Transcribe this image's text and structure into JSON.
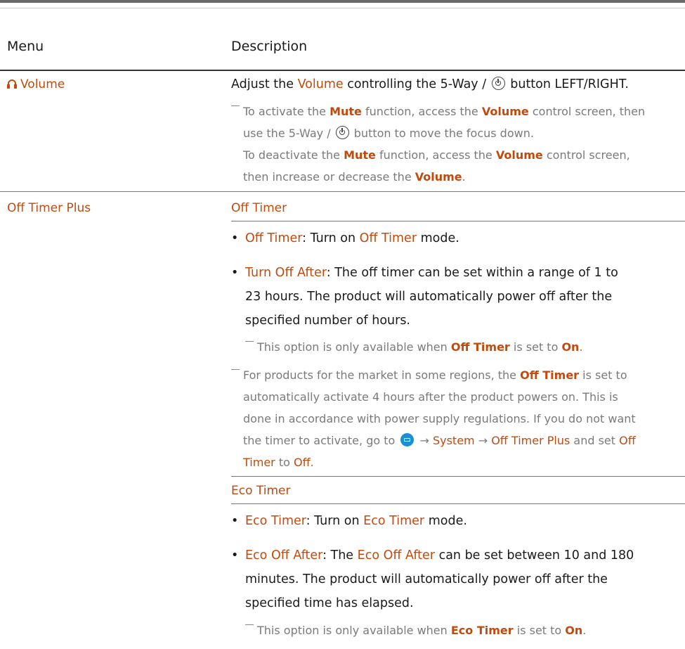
{
  "header": {
    "menu": "Menu",
    "description": "Description"
  },
  "volume": {
    "label": "Volume",
    "line": [
      "Adjust the ",
      "Volume",
      " controlling the 5-Way / ",
      " button LEFT/RIGHT."
    ],
    "note1": [
      "To activate the ",
      "Mute",
      " function, access the ",
      "Volume",
      " control screen, then"
    ],
    "note2": [
      "use the 5-Way / ",
      " button to move the focus down."
    ],
    "note3": [
      "To deactivate the ",
      "Mute",
      " function, access the ",
      "Volume",
      " control screen,"
    ],
    "note4": [
      "then increase or decrease the ",
      "Volume",
      "."
    ]
  },
  "off_timer_plus": {
    "label": "Off Timer Plus",
    "sub1": "Off Timer",
    "b1": [
      "Off Timer",
      ": Turn on ",
      "Off Timer",
      " mode."
    ],
    "b2_key": "Turn Off After",
    "b2_line1": ": The off timer can be set within a range of 1 to",
    "b2_line2": "23 hours. The product will automatically power off after the",
    "b2_line3": "specified number of hours.",
    "b2_note": [
      "This option is only available when ",
      "Off Timer",
      " is set to ",
      "On",
      "."
    ],
    "note_a1": [
      "For products for the market in some regions, the ",
      "Off Timer",
      " is set to"
    ],
    "note_a2": "automatically activate 4 hours after the product powers on. This is",
    "note_a3": "done in accordance with power supply regulations. If you do not want",
    "note_a4": [
      "the timer to activate, go to ",
      " → ",
      "System",
      " → ",
      "Off Timer Plus",
      " and set ",
      "Off"
    ],
    "note_a5": [
      "Timer",
      " to ",
      "Off",
      "."
    ],
    "sub2": "Eco Timer",
    "e1": [
      "Eco Timer",
      ": Turn on ",
      "Eco Timer",
      " mode."
    ],
    "e2_line1": [
      "Eco Off After",
      ": The ",
      "Eco Off After",
      " can be set between 10 and 180"
    ],
    "e2_line2": "minutes. The product will automatically power off after the",
    "e2_line3": "specified time has elapsed.",
    "e_note": [
      "This option is only available when ",
      "Eco Timer",
      " is set to ",
      "On",
      "."
    ]
  },
  "icons": {
    "bullet": "•"
  },
  "colors": {
    "accent": "#c24a0c",
    "note": "#7a7a7a",
    "text": "#1a1a1a"
  }
}
